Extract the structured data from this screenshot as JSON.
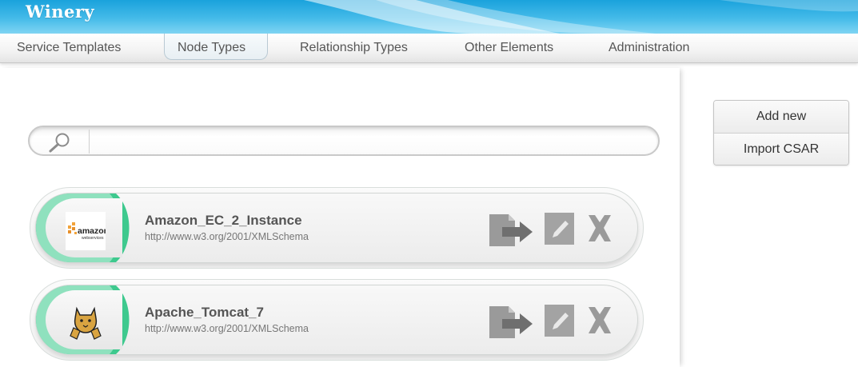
{
  "app": {
    "title": "Winery"
  },
  "nav": {
    "tabs": [
      {
        "label": "Service Templates",
        "active": false
      },
      {
        "label": "Node Types",
        "active": true
      },
      {
        "label": "Relationship Types",
        "active": false
      },
      {
        "label": "Other Elements",
        "active": false
      },
      {
        "label": "Administration",
        "active": false
      }
    ]
  },
  "search": {
    "placeholder": "",
    "value": "",
    "icon": "search-icon"
  },
  "sidebar": {
    "add_new_label": "Add new",
    "import_csar_label": "Import CSAR"
  },
  "items": [
    {
      "name": "Amazon_EC_2_Instance",
      "namespace": "http://www.w3.org/2001/XMLSchema",
      "icon": "amazon-webservices-logo",
      "logo_text": "amazon",
      "logo_subtext": "webservices"
    },
    {
      "name": "Apache_Tomcat_7",
      "namespace": "http://www.w3.org/2001/XMLSchema",
      "icon": "tomcat-logo"
    }
  ],
  "colors": {
    "accent_green": "#3ec98e",
    "header_blue": "#1aa2dc",
    "icon_grey": "#8a8a8a"
  }
}
